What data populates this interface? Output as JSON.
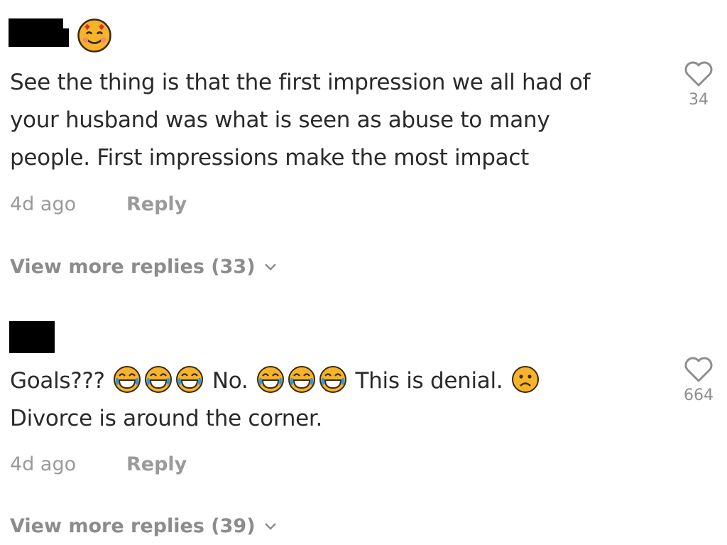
{
  "comments": [
    {
      "text_lines": [
        "See the thing is that the first impression we all had of",
        "your husband was what is seen as abuse to many",
        "people. First impressions make the most impact"
      ],
      "time": "4d ago",
      "reply_label": "Reply",
      "likes": "34",
      "view_more": "View more replies (33)",
      "avatar_icon": "heart-eyes-smiling-emoji-icon"
    },
    {
      "text_parts": {
        "p1": "Goals???",
        "p2": "No.",
        "p3": "This is denial.",
        "line2": "Divorce is around the corner."
      },
      "emoji_icons": [
        "tears-of-joy-emoji-icon",
        "slightly-frowning-emoji-icon"
      ],
      "time": "4d ago",
      "reply_label": "Reply",
      "likes": "664",
      "view_more": "View more replies (39)"
    }
  ],
  "colors": {
    "text": "#2a2a2a",
    "muted": "#9a9a9a",
    "background": "#ffffff"
  }
}
